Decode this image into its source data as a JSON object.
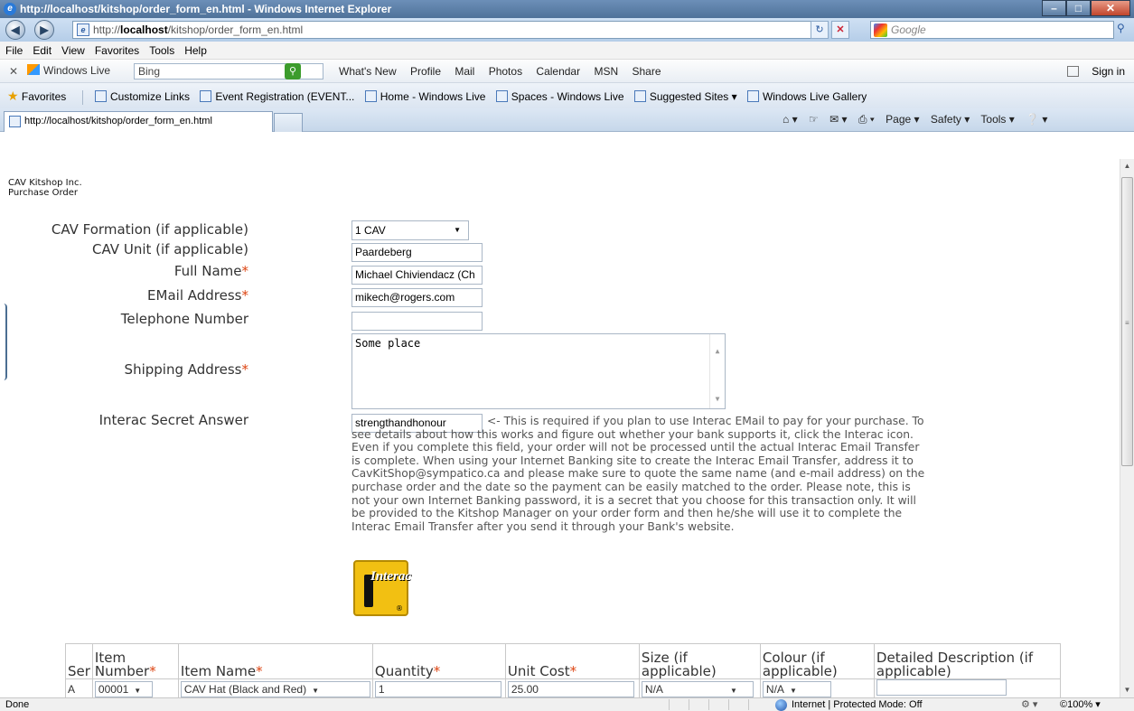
{
  "window": {
    "title": "http://localhost/kitshop/order_form_en.html - Windows Internet Explorer",
    "buttons": {
      "min": "–",
      "max": "□",
      "close": "✕"
    }
  },
  "address_bar": {
    "url_prefix": "http://",
    "url_host": "localhost",
    "url_path": "/kitshop/order_form_en.html",
    "search_placeholder": "Google"
  },
  "menu": [
    "File",
    "Edit",
    "View",
    "Favorites",
    "Tools",
    "Help"
  ],
  "live_toolbar": {
    "brand": "Windows Live",
    "search_value": "Bing",
    "links": [
      "What's New",
      "Profile",
      "Mail",
      "Photos",
      "Calendar",
      "MSN",
      "Share"
    ],
    "sign_in": "Sign in"
  },
  "favorites_bar": {
    "favorites_label": "Favorites",
    "links": [
      "Customize Links",
      "Event Registration (EVENT...",
      "Home - Windows Live",
      "Spaces - Windows Live",
      "Suggested Sites ▾",
      "Windows Live Gallery"
    ]
  },
  "tab": {
    "title": "http://localhost/kitshop/order_form_en.html"
  },
  "command_bar": [
    "Page ▾",
    "Safety ▾",
    "Tools ▾"
  ],
  "page": {
    "company": "CAV Kitshop Inc.",
    "doc_title": "Purchase Order",
    "required_marker": "*",
    "labels": {
      "formation": "CAV Formation (if applicable)",
      "unit": "CAV Unit (if applicable)",
      "full_name": "Full Name",
      "email": "EMail Address",
      "telephone": "Telephone Number",
      "shipping": "Shipping Address",
      "interac": "Interac Secret Answer"
    },
    "values": {
      "formation": "1 CAV",
      "unit": "Paardeberg",
      "full_name": "Michael Chiviendacz (Ch",
      "email": "mikech@rogers.com",
      "telephone": "",
      "shipping": "Some place",
      "interac": "strengthandhonour"
    },
    "interac_note": "<- This is required if you plan to use Interac EMail to pay for your purchase. To see details about how this works and figure out whether your bank supports it, click the Interac icon. Even if you complete this field, your order will not be processed until the actual Interac Email Transfer is complete. When using your Internet Banking site to create the Interac Email Transfer, address it to CavKitShop@sympatico.ca and please make sure to quote the same name (and e-mail address) on the purchase order and the date so the payment can be easily matched to the order. Please note, this is not your own Internet Banking password, it is a secret that you choose for this transaction only. It will be provided to the Kitshop Manager on your order form and then he/she will use it to complete the Interac Email Transfer after you send it through your Bank's website.",
    "interac_logo_text": "Interac",
    "interac_logo_reg": "®",
    "table": {
      "headers": {
        "ser": "Ser",
        "item_number": "Item Number",
        "item_name": "Item Name",
        "quantity": "Quantity",
        "unit_cost": "Unit Cost",
        "size": "Size (if applicable)",
        "colour": "Colour (if applicable)",
        "description": "Detailed Description (if applicable)"
      },
      "rows": [
        {
          "ser": "A",
          "item_number": "00001",
          "item_name": "CAV Hat (Black and Red)",
          "quantity": "1",
          "unit_cost": "25.00",
          "size": "N/A",
          "colour": "N/A",
          "description": ""
        }
      ]
    }
  },
  "status_bar": {
    "status": "Done",
    "zone": "Internet | Protected Mode: Off",
    "zoom": "©100%  ▾"
  }
}
